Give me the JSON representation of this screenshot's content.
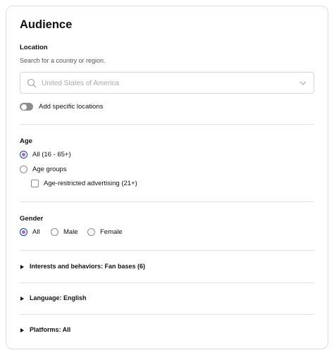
{
  "title": "Audience",
  "location": {
    "label": "Location",
    "hint": "Search for a country or region.",
    "search_placeholder": "United States of America",
    "toggle_label": "Add specific locations"
  },
  "age": {
    "label": "Age",
    "options": [
      "All (16 - 65+)",
      "Age groups"
    ],
    "selected": "All (16 - 65+)",
    "checkbox_label": "Age-restricted advertising (21+)"
  },
  "gender": {
    "label": "Gender",
    "options": [
      "All",
      "Male",
      "Female"
    ],
    "selected": "All"
  },
  "sections": [
    {
      "label": "Interests and behaviors: Fan bases (6)"
    },
    {
      "label": "Language: English"
    },
    {
      "label": "Platforms: All"
    }
  ],
  "colors": {
    "radio_selected_fill": "#9b6ac0",
    "radio_selected_ring": "#1f3a8a",
    "toggle_off": "#8c8c8c"
  }
}
